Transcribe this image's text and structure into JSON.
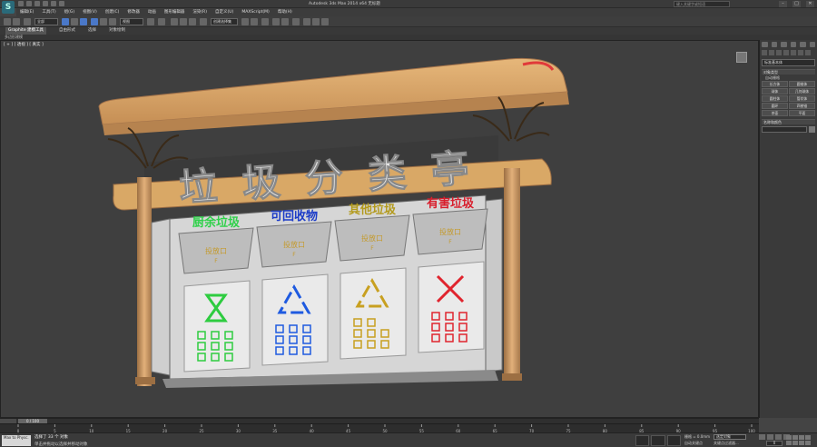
{
  "window": {
    "title": "Autodesk 3ds Max 2014 x64    无标题",
    "help_search_placeholder": "键入关键字或短语"
  },
  "menu": [
    "编辑(E)",
    "工具(T)",
    "组(G)",
    "视图(V)",
    "创建(C)",
    "修改器",
    "动画",
    "图形编辑器",
    "渲染(R)",
    "自定义(U)",
    "MAXScript(M)",
    "帮助(H)"
  ],
  "toolbar": {
    "selection_filter": "全部",
    "reference_coord": "视图",
    "named_selection": "创建选择集"
  },
  "ribbon": {
    "tabs": [
      "Graphite 建模工具",
      "自由形式",
      "选择",
      "对象绘制"
    ],
    "active_tab": "Graphite 建模工具",
    "panel_label": "多边形建模"
  },
  "viewport": {
    "label": "[ + ] [ 透视 ] [ 真实 ]",
    "scene": {
      "roof_title": "垃圾分类亭",
      "bins": [
        {
          "label": "厨余垃圾",
          "color": "#2fd14a",
          "panel_color": "#2ecc40",
          "sub": "投放口",
          "sub2": "F"
        },
        {
          "label": "可回收物",
          "color": "#1c3cc8",
          "panel_color": "#1e5ae0",
          "sub": "投放口",
          "sub2": "F"
        },
        {
          "label": "其他垃圾",
          "color": "#b39a1c",
          "panel_color": "#c8a020",
          "sub": "投放口",
          "sub2": "F"
        },
        {
          "label": "有害垃圾",
          "color": "#d81e2c",
          "panel_color": "#e0242e",
          "sub": "投放口",
          "sub2": "F"
        }
      ],
      "gold": "#d7a664",
      "gold_dark": "#a9794a"
    }
  },
  "command_panel": {
    "category": "标准基本体",
    "object_type_header": "对象类型",
    "autogrid_label": "自动栅格",
    "buttons": [
      "长方体",
      "圆锥体",
      "球体",
      "几何球体",
      "圆柱体",
      "管状体",
      "圆环",
      "四棱锥",
      "茶壶",
      "平面"
    ],
    "name_color_header": "名称和颜色"
  },
  "timeline": {
    "slider": "0 / 100",
    "ticks": [
      "0",
      "5",
      "10",
      "15",
      "20",
      "25",
      "30",
      "35",
      "40",
      "45",
      "50",
      "55",
      "60",
      "65",
      "70",
      "75",
      "80",
      "85",
      "90",
      "95",
      "100"
    ]
  },
  "status": {
    "script_label": "Max to Physc.",
    "selected": "选择了 33 个 对象",
    "prompt": "单击并拖动以选择并移动对象",
    "grid": "栅格 = 0.0mm",
    "add_time_tag": "添加时间标记",
    "auto_key": "自动关键点",
    "set_key": "选定对象",
    "key_filters": "关键点过滤器...",
    "frame": "0"
  }
}
